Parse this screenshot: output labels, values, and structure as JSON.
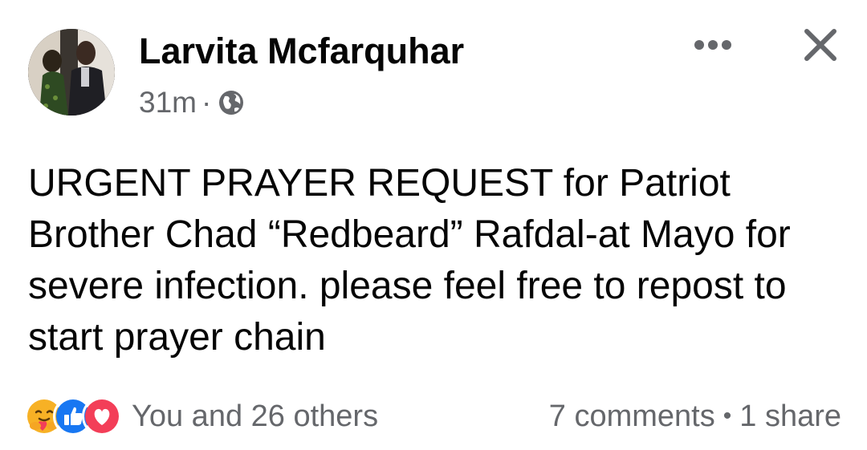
{
  "post": {
    "author": "Larvita Mcfarquhar",
    "time": "31m",
    "separator": "·",
    "privacy_icon": "globe-icon",
    "body": "URGENT PRAYER REQUEST for Patriot Brother Chad “Redbeard” Rafdal-at Mayo for severe infection. please feel free to repost to start prayer chain"
  },
  "header": {
    "more_icon": "more-options-icon",
    "close_icon": "close-icon"
  },
  "footer": {
    "reaction_icons": [
      "care-reaction-icon",
      "like-reaction-icon",
      "love-reaction-icon"
    ],
    "reaction_summary": "You and 26 others",
    "comments": "7 comments",
    "bullet": "•",
    "shares": "1 share"
  },
  "colors": {
    "text_primary": "#050505",
    "text_secondary": "#65676b",
    "like_blue": "#1877f2",
    "love_red": "#f33e58",
    "care_yellow": "#f7b125"
  }
}
